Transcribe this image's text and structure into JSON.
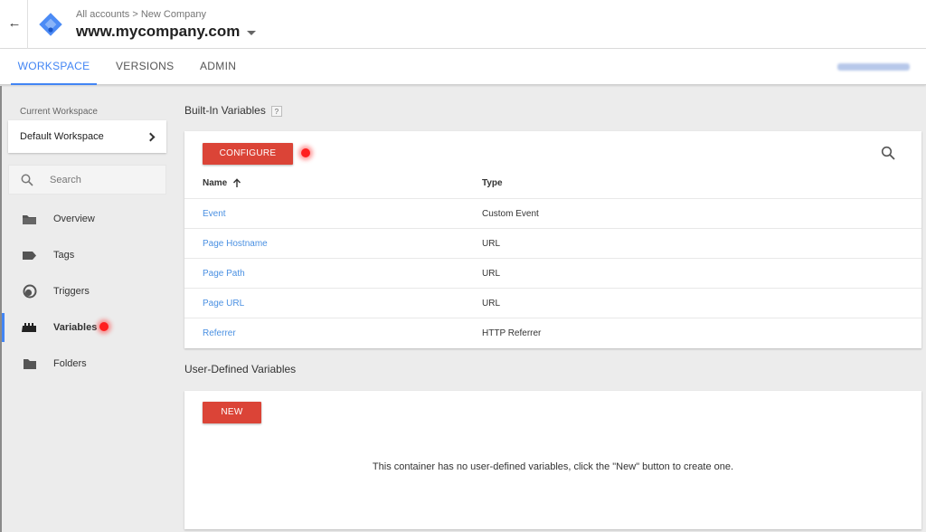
{
  "header": {
    "back_icon": "arrow-left-icon",
    "breadcrumb": "All accounts > New Company",
    "container_name": "www.mycompany.com"
  },
  "tabs": [
    {
      "label": "WORKSPACE",
      "active": true
    },
    {
      "label": "VERSIONS",
      "active": false
    },
    {
      "label": "ADMIN",
      "active": false
    }
  ],
  "sidebar": {
    "workspace_label": "Current Workspace",
    "workspace_name": "Default Workspace",
    "search_placeholder": "Search",
    "items": [
      {
        "label": "Overview",
        "icon": "folder-open-icon"
      },
      {
        "label": "Tags",
        "icon": "tag-icon"
      },
      {
        "label": "Triggers",
        "icon": "trigger-icon"
      },
      {
        "label": "Variables",
        "icon": "variables-icon",
        "active": true
      },
      {
        "label": "Folders",
        "icon": "folder-icon"
      }
    ]
  },
  "builtin": {
    "title": "Built-In Variables",
    "help": "?",
    "configure_label": "CONFIGURE",
    "columns": {
      "name": "Name",
      "type": "Type"
    },
    "rows": [
      {
        "name": "Event",
        "type": "Custom Event"
      },
      {
        "name": "Page Hostname",
        "type": "URL"
      },
      {
        "name": "Page Path",
        "type": "URL"
      },
      {
        "name": "Page URL",
        "type": "URL"
      },
      {
        "name": "Referrer",
        "type": "HTTP Referrer"
      }
    ]
  },
  "user_defined": {
    "title": "User-Defined Variables",
    "new_label": "NEW",
    "empty_message": "This container has no user-defined variables, click the \"New\" button to create one."
  },
  "colors": {
    "accent": "#4285f4",
    "button_red": "#db4437",
    "link": "#4a90e2"
  }
}
